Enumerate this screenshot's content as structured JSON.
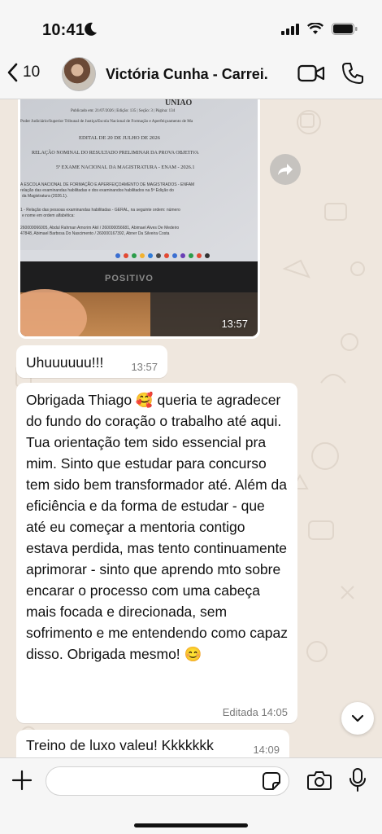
{
  "status_bar": {
    "time": "10:41"
  },
  "header": {
    "back_count": "10",
    "contact_name": "Victória Cunha - Carrei..."
  },
  "photo_message": {
    "time": "13:57",
    "document": {
      "masthead": "UNIÃO",
      "publication_line": "Publicado em: 21/07/2026 | Edição: 135 | Seção: 3 | Página: 134",
      "organ_line": "Poder Judiciário/Superior Tribunal de Justiça/Escola Nacional de Formação e Aperfeiçoamento de Ma",
      "edital": "EDITAL DE 20 DE JULHO DE 2026",
      "title": "RELAÇÃO NOMINAL DO RESULTADO PRELIMINAR DA PROVA OBJETIVA",
      "subtitle": "5º EXAME NACIONAL DA MAGISTRATURA - ENAM - 2026.1",
      "body_lines": [
        "A ESCOLA NACIONAL DE FORMAÇÃO E APERFEIÇOAMENTO DE MAGISTRADOS - ENFAM",
        "relação das examinandas habilitadas e dos examinandos habilitados na 5ª Edição do",
        "da Magistratura (2026.1).",
        "1 - Relação das pessoas examinandas habilitadas - GERAL, na seguinte ordem: número",
        "e nome em ordem alfabética:",
        "260000066005, Abdul Rahman Amorim Akil / 260000056681, Abimael Alves De Medeiro",
        "47848, Abimael Barbosa Do Nascimento / 260000167392, Abner Da Silveira Costa"
      ],
      "monitor_brand": "POSITIVO"
    }
  },
  "messages": [
    {
      "text": "Uhuuuuuu!!!",
      "time": "13:57"
    },
    {
      "text": "Obrigada Thiago 🥰 queria te agradecer do fundo do coração o trabalho até aqui. Tua orientação tem sido essencial pra mim. Sinto que estudar para concurso tem sido bem transformador até. Além da eficiência e da forma de estudar - que até eu começar a mentoria contigo estava perdida, mas tento continuamente aprimorar - sinto que aprendo mto sobre encarar o processo com uma cabeça mais focada e direcionada, sem sofrimento e me entendendo como capaz disso. Obrigada mesmo! 😊",
      "edited_label": "Editada",
      "time": "14:05"
    },
    {
      "text": "Treino de luxo valeu! Kkkkkkk",
      "time": "14:09"
    }
  ],
  "input": {
    "value": "",
    "placeholder": ""
  },
  "colors": {
    "chat_background": "#efe7de",
    "bubble": "#ffffff",
    "bars": "#f6f6f6",
    "timestamp": "#7a7a7a"
  }
}
